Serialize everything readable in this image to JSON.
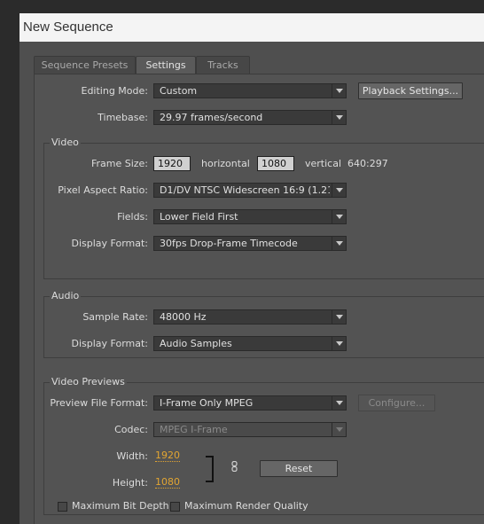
{
  "window": {
    "title": "New Sequence"
  },
  "tabs": [
    {
      "label": "Sequence Presets"
    },
    {
      "label": "Settings"
    },
    {
      "label": "Tracks"
    }
  ],
  "settings": {
    "editing_mode": {
      "label": "Editing Mode:",
      "value": "Custom"
    },
    "playback_settings_label": "Playback Settings...",
    "timebase": {
      "label": "Timebase:",
      "value": "29.97 frames/second"
    }
  },
  "video": {
    "group_title": "Video",
    "frame_size": {
      "label": "Frame Size:",
      "horizontal_value": "1920",
      "horizontal_label": "horizontal",
      "vertical_value": "1080",
      "vertical_label": "vertical",
      "ratio": "640:297"
    },
    "pixel_aspect_ratio": {
      "label": "Pixel Aspect Ratio:",
      "value": "D1/DV NTSC Widescreen 16:9 (1.21..."
    },
    "fields": {
      "label": "Fields:",
      "value": "Lower Field First"
    },
    "display_format": {
      "label": "Display Format:",
      "value": "30fps Drop-Frame Timecode"
    }
  },
  "audio": {
    "group_title": "Audio",
    "sample_rate": {
      "label": "Sample Rate:",
      "value": "48000 Hz"
    },
    "display_format": {
      "label": "Display Format:",
      "value": "Audio Samples"
    }
  },
  "video_previews": {
    "group_title": "Video Previews",
    "preview_file_format": {
      "label": "Preview File Format:",
      "value": "I-Frame Only MPEG"
    },
    "configure_label": "Configure...",
    "codec": {
      "label": "Codec:",
      "value": "MPEG I-Frame"
    },
    "width": {
      "label": "Width:",
      "value": "1920"
    },
    "height": {
      "label": "Height:",
      "value": "1080"
    },
    "reset_label": "Reset",
    "max_bit_depth": {
      "label": "Maximum Bit Depth",
      "checked": false
    },
    "max_render_quality": {
      "label": "Maximum Render Quality",
      "checked": false
    }
  },
  "colors": {
    "dialog_bg": "#535353",
    "accent_value": "#e2a532"
  },
  "icons": {
    "link": "chain-link-icon",
    "dropdown": "chevron-down-icon"
  }
}
